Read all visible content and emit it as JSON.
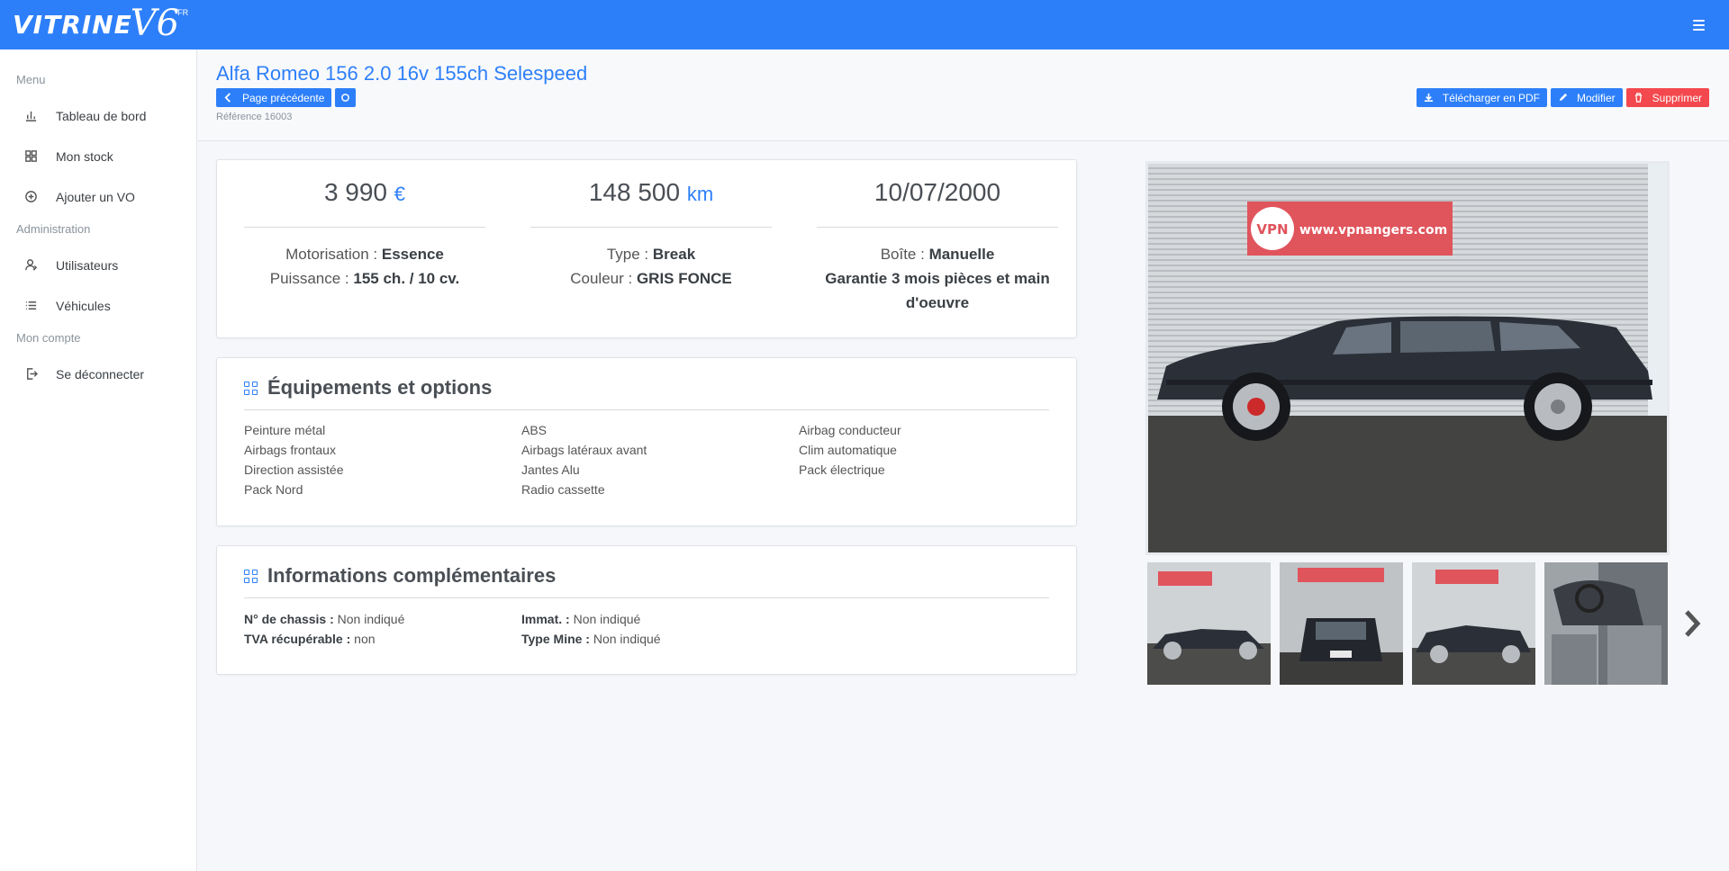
{
  "brand": {
    "name": "VITRINE",
    "version": "V6",
    "suffix": "FR"
  },
  "sidebar": {
    "sections": [
      {
        "title": "Menu",
        "items": [
          {
            "label": "Tableau de bord",
            "icon": "bar-chart-icon"
          },
          {
            "label": "Mon stock",
            "icon": "grid-icon"
          },
          {
            "label": "Ajouter un VO",
            "icon": "plus-circle-icon"
          }
        ]
      },
      {
        "title": "Administration",
        "items": [
          {
            "label": "Utilisateurs",
            "icon": "user-icon"
          },
          {
            "label": "Véhicules",
            "icon": "list-icon"
          }
        ]
      },
      {
        "title": "Mon compte",
        "items": [
          {
            "label": "Se déconnecter",
            "icon": "logout-icon"
          }
        ]
      }
    ]
  },
  "header": {
    "title": "Alfa Romeo 156 2.0 16v 155ch Selespeed",
    "back_label": "Page précédente",
    "reference": "Référence 16003",
    "actions": {
      "pdf": "Télécharger en PDF",
      "edit": "Modifier",
      "delete": "Supprimer"
    }
  },
  "summary": {
    "price": {
      "value": "3 990",
      "unit": "€"
    },
    "mileage": {
      "value": "148 500",
      "unit": "km"
    },
    "date": "10/07/2000",
    "motorisation_label": "Motorisation :",
    "motorisation": "Essence",
    "puissance_label": "Puissance :",
    "puissance": "155 ch. / 10 cv.",
    "type_label": "Type :",
    "type": "Break",
    "couleur_label": "Couleur :",
    "couleur": "GRIS FONCE",
    "boite_label": "Boîte :",
    "boite": "Manuelle",
    "garantie": "Garantie 3 mois pièces et main d'oeuvre"
  },
  "equipment": {
    "title": "Équipements et options",
    "items": [
      "Peinture métal",
      "ABS",
      "Airbag conducteur",
      "Airbags frontaux",
      "Airbags latéraux avant",
      "Clim automatique",
      "Direction assistée",
      "Jantes Alu",
      "Pack électrique",
      "Pack Nord",
      "Radio cassette"
    ]
  },
  "extra": {
    "title": "Informations complémentaires",
    "chassis_label": "N° de chassis :",
    "chassis": "Non indiqué",
    "immat_label": "Immat. :",
    "immat": "Non indiqué",
    "tva_label": "TVA récupérable :",
    "tva": "non",
    "mine_label": "Type Mine :",
    "mine": "Non indiqué"
  },
  "photo": {
    "banner": "www.vpnangers.com",
    "logo": "VPN"
  },
  "colors": {
    "accent": "#2d7ff9",
    "danger": "#f3484d",
    "car": "#2b3038"
  }
}
